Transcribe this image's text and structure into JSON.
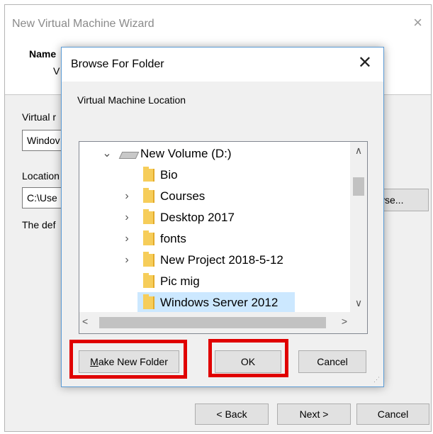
{
  "wizard": {
    "title": "New Virtual Machine Wizard",
    "close_icon": "×",
    "header_title": "Name",
    "header_sub": "V",
    "vm_name_label": "Virtual r",
    "vm_name_value": "Windov",
    "location_label": "Location",
    "location_value": "C:\\Use",
    "browse_label": "vse...",
    "default_note": "The def",
    "back_label": "< Back",
    "next_label": "Next >",
    "cancel_label": "Cancel"
  },
  "dialog": {
    "title": "Browse For Folder",
    "close_icon": "✕",
    "description": "Virtual Machine Location",
    "tree": [
      {
        "label": "New Volume (D:)",
        "icon": "drive-icon",
        "expander": "expanded",
        "level": 0,
        "selected": false
      },
      {
        "label": "Bio",
        "icon": "folder-icon",
        "expander": "none",
        "level": 1,
        "selected": false
      },
      {
        "label": "Courses",
        "icon": "folder-icon",
        "expander": "collapsed",
        "level": 1,
        "selected": false
      },
      {
        "label": "Desktop 2017",
        "icon": "folder-icon",
        "expander": "collapsed",
        "level": 1,
        "selected": false
      },
      {
        "label": "fonts",
        "icon": "folder-icon",
        "expander": "collapsed",
        "level": 1,
        "selected": false
      },
      {
        "label": "New Project 2018-5-12",
        "icon": "folder-icon",
        "expander": "collapsed",
        "level": 1,
        "selected": false
      },
      {
        "label": "Pic mig",
        "icon": "folder-icon",
        "expander": "none",
        "level": 1,
        "selected": false
      },
      {
        "label": "Windows Server 2012",
        "icon": "folder-icon",
        "expander": "none",
        "level": 1,
        "selected": true
      }
    ],
    "scroll_glyphs": {
      "up": "∧",
      "down": "∨",
      "left": "<",
      "right": ">"
    },
    "make_new_folder_label": "Make New Folder",
    "ok_label": "OK",
    "cancel_label": "Cancel"
  },
  "colors": {
    "highlight": "#e00000",
    "selection": "#cce8ff",
    "folder": "#f6cd5a",
    "dialog_border": "#5b9bd5"
  }
}
